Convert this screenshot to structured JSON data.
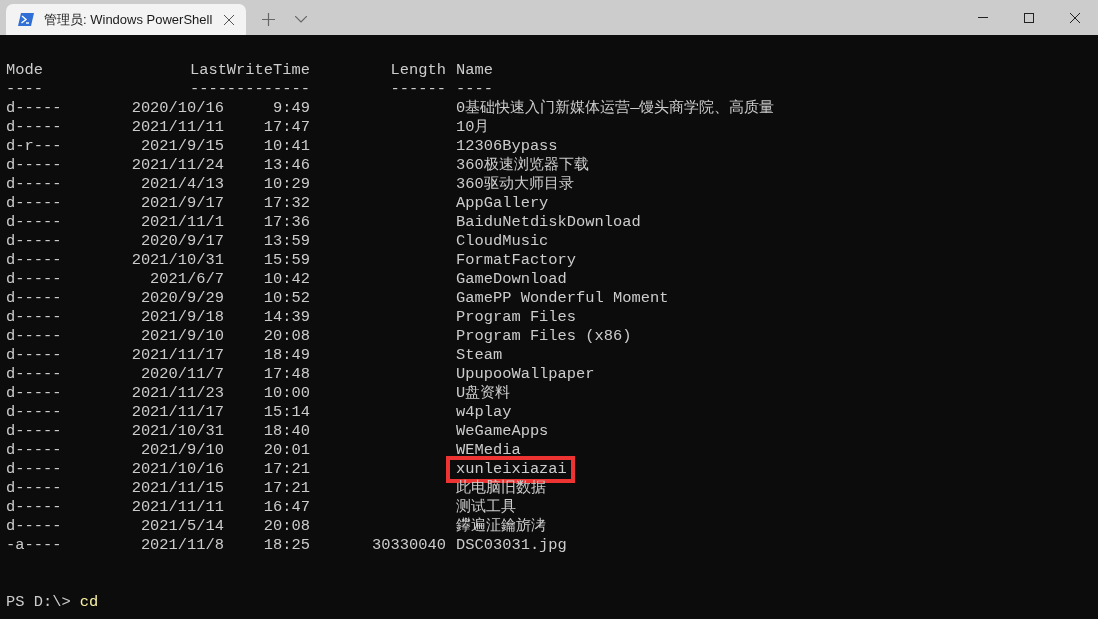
{
  "tab": {
    "title": "管理员: Windows PowerShell",
    "selected": true
  },
  "columns": [
    {
      "label": "Mode",
      "rule": "----"
    },
    {
      "label": "LastWriteTime",
      "rule": "-------------"
    },
    {
      "label": "Length",
      "rule": "------"
    },
    {
      "label": "Name",
      "rule": "----"
    }
  ],
  "rows": [
    {
      "mode": "d-----",
      "date": "2020/10/16",
      "time": "9:49",
      "name": "0基础快速入门新媒体运营—馒头商学院、高质量",
      "highlighted": false
    },
    {
      "mode": "d-----",
      "date": "2021/11/11",
      "time": "17:47",
      "name": "10月",
      "highlighted": false
    },
    {
      "mode": "d-r---",
      "date": "2021/9/15",
      "time": "10:41",
      "name": "12306Bypass",
      "highlighted": false
    },
    {
      "mode": "d-----",
      "date": "2021/11/24",
      "time": "13:46",
      "name": "360极速浏览器下载",
      "highlighted": false
    },
    {
      "mode": "d-----",
      "date": "2021/4/13",
      "time": "10:29",
      "name": "360驱动大师目录",
      "highlighted": false
    },
    {
      "mode": "d-----",
      "date": "2021/9/17",
      "time": "17:32",
      "name": "AppGallery",
      "highlighted": false
    },
    {
      "mode": "d-----",
      "date": "2021/11/1",
      "time": "17:36",
      "name": "BaiduNetdiskDownload",
      "highlighted": false
    },
    {
      "mode": "d-----",
      "date": "2020/9/17",
      "time": "13:59",
      "name": "CloudMusic",
      "highlighted": false
    },
    {
      "mode": "d-----",
      "date": "2021/10/31",
      "time": "15:59",
      "name": "FormatFactory",
      "highlighted": false
    },
    {
      "mode": "d-----",
      "date": "2021/6/7",
      "time": "10:42",
      "name": "GameDownload",
      "highlighted": false
    },
    {
      "mode": "d-----",
      "date": "2020/9/29",
      "time": "10:52",
      "name": "GamePP Wonderful Moment",
      "highlighted": false
    },
    {
      "mode": "d-----",
      "date": "2021/9/18",
      "time": "14:39",
      "name": "Program Files",
      "highlighted": false
    },
    {
      "mode": "d-----",
      "date": "2021/9/10",
      "time": "20:08",
      "name": "Program Files (x86)",
      "highlighted": false
    },
    {
      "mode": "d-----",
      "date": "2021/11/17",
      "time": "18:49",
      "name": "Steam",
      "highlighted": false
    },
    {
      "mode": "d-----",
      "date": "2020/11/7",
      "time": "17:48",
      "name": "UpupooWallpaper",
      "highlighted": false
    },
    {
      "mode": "d-----",
      "date": "2021/11/23",
      "time": "10:00",
      "name": "U盘资料",
      "highlighted": false
    },
    {
      "mode": "d-----",
      "date": "2021/11/17",
      "time": "15:14",
      "name": "w4play",
      "highlighted": false
    },
    {
      "mode": "d-----",
      "date": "2021/10/31",
      "time": "18:40",
      "name": "WeGameApps",
      "highlighted": false
    },
    {
      "mode": "d-----",
      "date": "2021/9/10",
      "time": "20:01",
      "name": "WEMedia",
      "highlighted": false
    },
    {
      "mode": "d-----",
      "date": "2021/10/16",
      "time": "17:21",
      "name": "xunleixiazai",
      "highlighted": true
    },
    {
      "mode": "d-----",
      "date": "2021/11/15",
      "time": "17:21",
      "name": "此电脑旧数据",
      "highlighted": false
    },
    {
      "mode": "d-----",
      "date": "2021/11/11",
      "time": "16:47",
      "name": "测试工具",
      "highlighted": false
    },
    {
      "mode": "d-----",
      "date": "2021/5/14",
      "time": "20:08",
      "name": "鑻遍泟鑰旂洘",
      "highlighted": false
    },
    {
      "mode": "-a----",
      "date": "2021/11/8",
      "time": "18:25",
      "length": "30330040",
      "name": "DSC03031.jpg",
      "highlighted": false
    }
  ],
  "prompt": {
    "text": "PS D:\\>",
    "command": "cd"
  }
}
